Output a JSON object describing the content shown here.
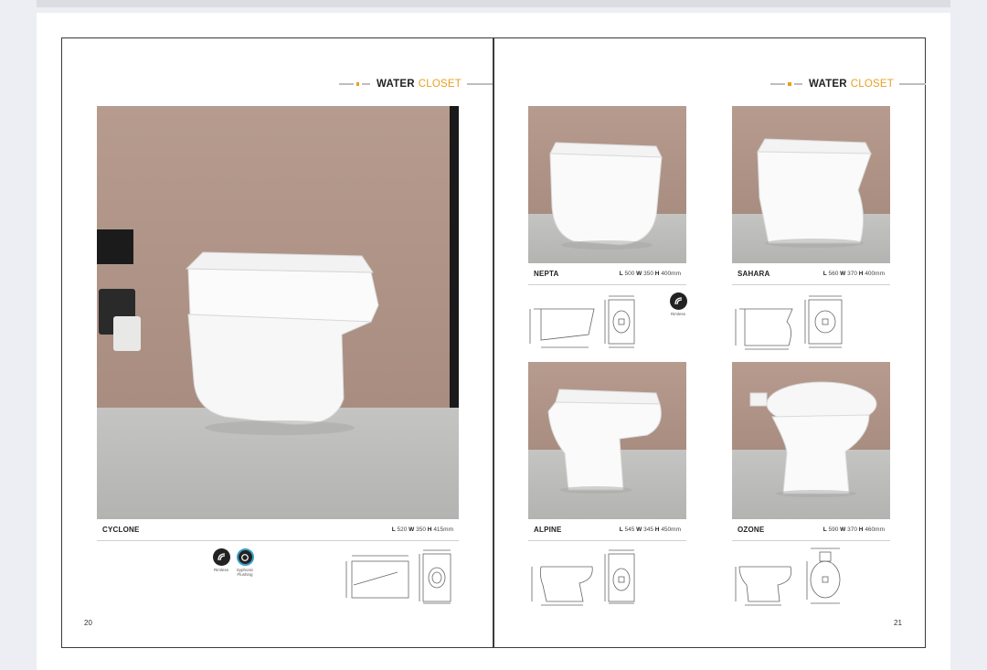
{
  "header": {
    "title_bold": "WATER",
    "title_accent": "CLOSET"
  },
  "colors": {
    "accent": "#e8a020",
    "frame": "#3a3a3a"
  },
  "pages": {
    "left_number": "20",
    "right_number": "21"
  },
  "products": [
    {
      "name": "CYCLONE",
      "L": "520",
      "W": "350",
      "H": "415mm"
    },
    {
      "name": "NEPTA",
      "L": "500",
      "W": "350",
      "H": "400mm"
    },
    {
      "name": "SAHARA",
      "L": "560",
      "W": "370",
      "H": "400mm"
    },
    {
      "name": "ALPINE",
      "L": "545",
      "W": "345",
      "H": "450mm"
    },
    {
      "name": "OZONE",
      "L": "590",
      "W": "370",
      "H": "460mm"
    }
  ],
  "dim_letters": {
    "L": "L",
    "W": "W",
    "H": "H"
  },
  "badges": {
    "rimless": "Rimless",
    "siphonic_line1": "Syphonic",
    "siphonic_line2": "Flushing"
  }
}
